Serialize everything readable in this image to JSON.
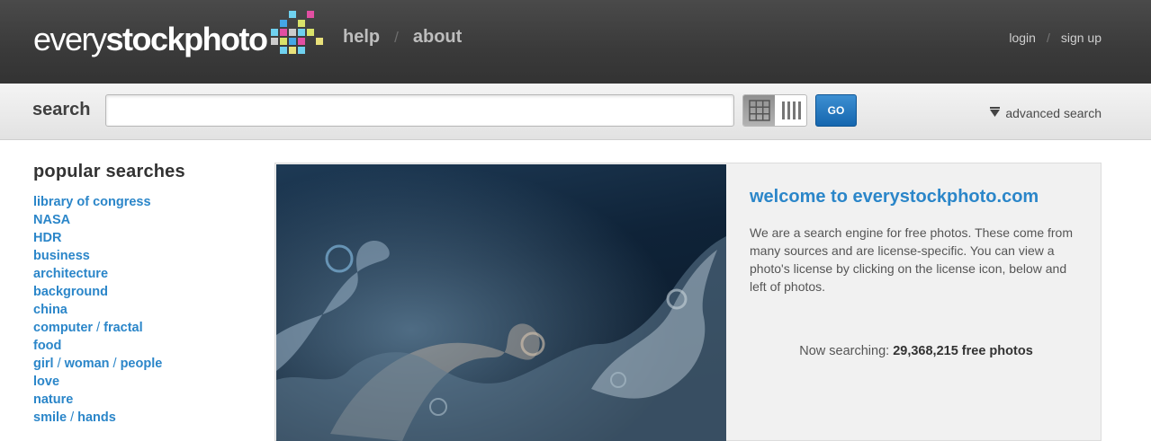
{
  "header": {
    "logo_part1": "every",
    "logo_part2": "stockphoto",
    "nav": [
      "help",
      "about"
    ],
    "nav_separator": "/",
    "auth": [
      "login",
      "sign up"
    ],
    "auth_separator": "/"
  },
  "search": {
    "label": "search",
    "value": "",
    "placeholder": "",
    "go_label": "GO",
    "advanced_label": "advanced search",
    "view_modes": [
      "grid-view-icon",
      "column-view-icon"
    ]
  },
  "sidebar": {
    "title": "popular searches",
    "items": [
      {
        "parts": [
          "library of congress"
        ]
      },
      {
        "parts": [
          "NASA"
        ]
      },
      {
        "parts": [
          "HDR"
        ]
      },
      {
        "parts": [
          "business"
        ]
      },
      {
        "parts": [
          "architecture"
        ]
      },
      {
        "parts": [
          "background"
        ]
      },
      {
        "parts": [
          "china"
        ]
      },
      {
        "parts": [
          "computer",
          "fractal"
        ]
      },
      {
        "parts": [
          "food"
        ]
      },
      {
        "parts": [
          "girl",
          "woman",
          "people"
        ]
      },
      {
        "parts": [
          "love"
        ]
      },
      {
        "parts": [
          "nature"
        ]
      },
      {
        "parts": [
          "smile",
          "hands"
        ]
      }
    ]
  },
  "feature": {
    "title": "welcome to everystockphoto.com",
    "description": "We are a search engine for free photos. These come from many sources and are license-specific. You can view a photo's license by clicking on the license icon, below and left of photos.",
    "count_prefix": "Now searching:",
    "count_value": "29,368,215 free photos"
  },
  "colors": {
    "link": "#2b86c9",
    "topbar": "#3a3a3a",
    "go_button": "#1f72bb"
  }
}
